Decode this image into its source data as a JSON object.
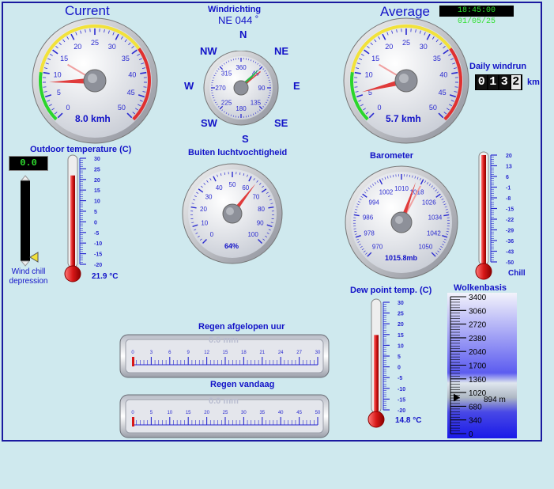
{
  "current": {
    "title": "Current",
    "value": 8.0,
    "avg_needle": 14,
    "readout": "8.0 kmh",
    "ticks": [
      "0",
      "5",
      "10",
      "15",
      "20",
      "25",
      "30",
      "35",
      "40",
      "45",
      "50"
    ]
  },
  "average": {
    "title": "Average",
    "value": 5.7,
    "avg_needle": 14,
    "readout": "5.7 kmh",
    "ticks": [
      "0",
      "5",
      "10",
      "15",
      "20",
      "25",
      "30",
      "35",
      "40",
      "45",
      "50"
    ]
  },
  "datetime": "18:45:00 01/05/25",
  "wind_direction": {
    "title": "Windrichting",
    "readout": "NE  044 ˚",
    "degrees": 44,
    "compass": {
      "n": "N",
      "ne": "NE",
      "e": "E",
      "se": "SE",
      "s": "S",
      "sw": "SW",
      "w": "W",
      "nw": "NW"
    },
    "ticks": [
      "360",
      "45",
      "90",
      "135",
      "180",
      "225",
      "270",
      "315"
    ]
  },
  "daily_windrun": {
    "title": "Daily windrun",
    "digits": [
      "0",
      "1",
      "3",
      "2"
    ],
    "unit": "km"
  },
  "outdoor_temperature": {
    "title": "Outdoor temperature (C)",
    "value_c": 21.9,
    "readout": "21.9 °C",
    "wind_chill_value": "0.0",
    "wind_chill_label_1": "Wind chill",
    "wind_chill_label_2": "depression",
    "scale": [
      "30",
      "25",
      "20",
      "15",
      "10",
      "5",
      "0",
      "-5",
      "-10",
      "-15",
      "-20"
    ]
  },
  "humidity": {
    "title": "Buiten luchtvochtigheid",
    "value_pct": 64,
    "readout": "64%",
    "ticks": [
      "0",
      "10",
      "20",
      "30",
      "40",
      "50",
      "60",
      "70",
      "80",
      "90",
      "100"
    ]
  },
  "barometer": {
    "title": "Barometer",
    "value_mb": 1015.8,
    "readout": "1015.8mb",
    "ticks": [
      "970",
      "978",
      "986",
      "994",
      "1002",
      "1010",
      "1018",
      "1026",
      "1034",
      "1042",
      "1050"
    ]
  },
  "chill": {
    "label": "Chill",
    "scale": [
      "20",
      "13",
      "6",
      "-1",
      "-8",
      "-15",
      "-22",
      "-29",
      "-36",
      "-43",
      "-50"
    ]
  },
  "dew_point": {
    "title": "Dew point temp. (C)",
    "value_c": 14.8,
    "readout": "14.8 °C",
    "scale": [
      "30",
      "25",
      "20",
      "15",
      "10",
      "5",
      "0",
      "-5",
      "-10",
      "-15",
      "-20"
    ]
  },
  "cloud_base": {
    "title": "Wolkenbasis",
    "value_m": 894,
    "readout": "894 m",
    "scale": [
      "3400",
      "3060",
      "2720",
      "2380",
      "2040",
      "1700",
      "1360",
      "1020",
      "680",
      "340",
      "0"
    ]
  },
  "rain_hour": {
    "title": "Regen afgelopen uur",
    "readout": "0.0 mm",
    "ticks": [
      "0",
      "3",
      "6",
      "9",
      "12",
      "15",
      "18",
      "21",
      "24",
      "27",
      "30"
    ]
  },
  "rain_today": {
    "title": "Regen vandaag",
    "readout": "0.0 mm",
    "ticks": [
      "0",
      "5",
      "10",
      "15",
      "20",
      "25",
      "30",
      "35",
      "40",
      "45",
      "50"
    ]
  },
  "colors": {
    "text": "#1212c8",
    "frame": "#1a1aa0",
    "needle": "#e03b3b",
    "background": "#cfe9ee"
  }
}
